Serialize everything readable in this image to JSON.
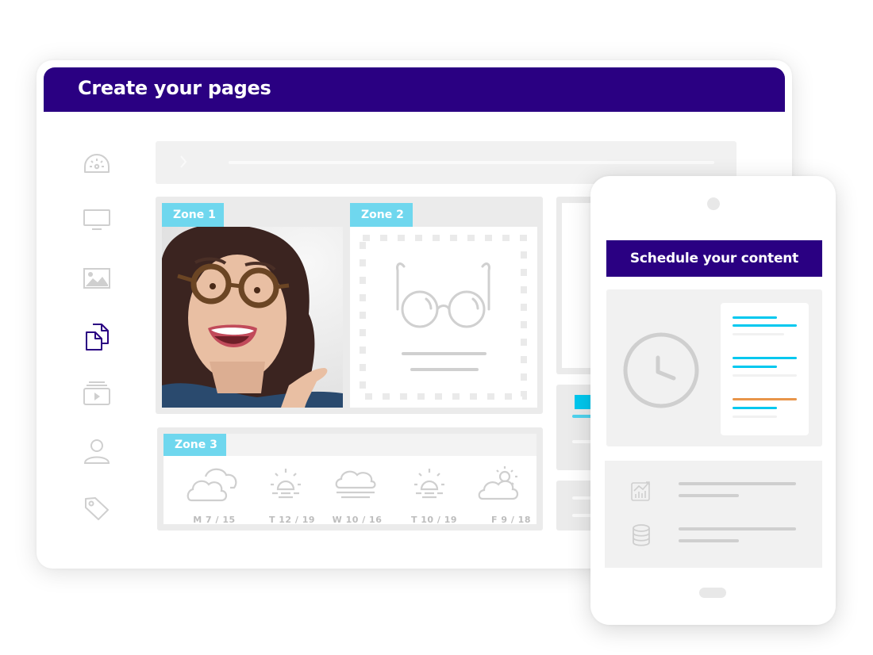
{
  "window": {
    "title": "Create your pages"
  },
  "sidebar": {
    "items": [
      {
        "name": "dashboard",
        "icon": "gauge-icon",
        "active": false
      },
      {
        "name": "screens",
        "icon": "monitor-icon",
        "active": false
      },
      {
        "name": "media",
        "icon": "image-icon",
        "active": false
      },
      {
        "name": "pages",
        "icon": "documents-icon",
        "active": true
      },
      {
        "name": "playlists",
        "icon": "playlist-icon",
        "active": false
      },
      {
        "name": "users",
        "icon": "user-icon",
        "active": false
      },
      {
        "name": "tags",
        "icon": "tag-icon",
        "active": false
      }
    ]
  },
  "zones": {
    "zone1": {
      "label": "Zone 1",
      "content": "photo"
    },
    "zone2": {
      "label": "Zone 2",
      "content": "glasses-placeholder"
    },
    "zone3": {
      "label": "Zone 3",
      "forecast": [
        {
          "day": "M",
          "low": "7",
          "high": "15",
          "label": "M   7 / 15",
          "icon": "cloudy-icon"
        },
        {
          "day": "T",
          "low": "12",
          "high": "19",
          "label": "T  12 / 19",
          "icon": "sunrise-icon"
        },
        {
          "day": "W",
          "low": "10",
          "high": "16",
          "label": "W  10 / 16",
          "icon": "fog-icon"
        },
        {
          "day": "T",
          "low": "10",
          "high": "19",
          "label": "T   10 / 19",
          "icon": "sunrise-icon"
        },
        {
          "day": "F",
          "low": "9",
          "high": "18",
          "label": "F   9 / 18",
          "icon": "partly-cloudy-icon"
        }
      ]
    }
  },
  "phone": {
    "title": "Schedule your content"
  },
  "colors": {
    "brand": "#2a0082",
    "zone_tag": "#6fd7ee",
    "accent_blue": "#00c8ef",
    "accent_orange": "#e8954a",
    "icon_gray": "#cfcfcf",
    "active_icon": "#2a0082"
  }
}
